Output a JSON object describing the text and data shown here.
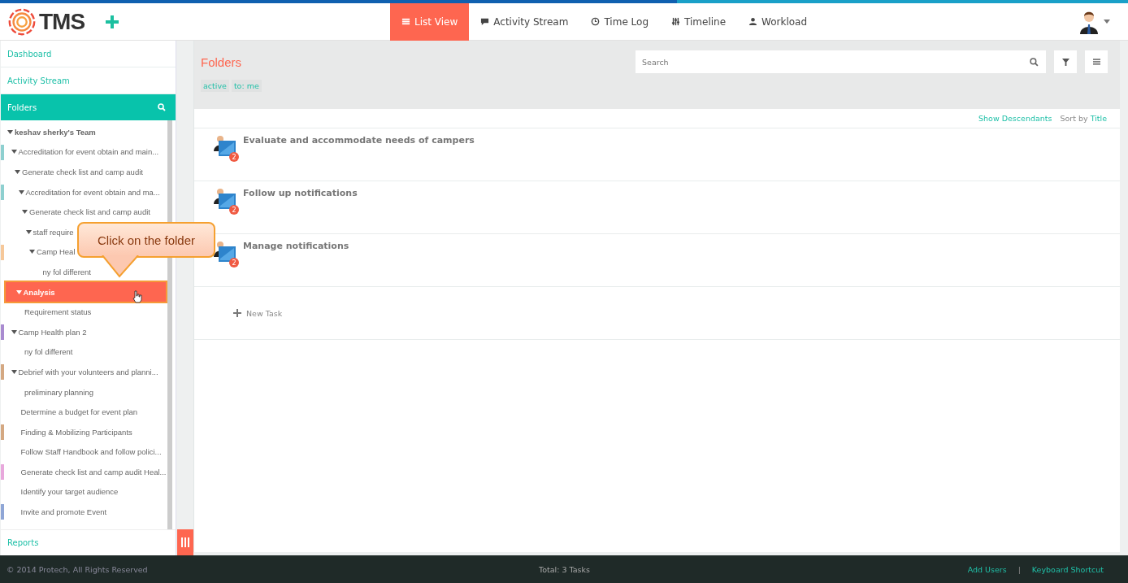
{
  "header": {
    "logo": "TMS",
    "views": [
      {
        "label": "List View",
        "selected": true
      },
      {
        "label": "Activity Stream",
        "selected": false
      },
      {
        "label": "Time Log",
        "selected": false
      },
      {
        "label": "Timeline",
        "selected": false
      },
      {
        "label": "Workload",
        "selected": false
      }
    ]
  },
  "sidebar": {
    "links": [
      "Dashboard",
      "Activity Stream"
    ],
    "folders_title": "Folders",
    "tree": [
      {
        "label": "keshav sherky's Team",
        "selected": false,
        "children": [
          {
            "label": "Accreditation for event obtain and main...",
            "color": "#8ed0d0",
            "selected": false,
            "children": [
              {
                "label": "Generate check list and camp audit",
                "selected": false,
                "children": [
                  {
                    "label": "Accreditation for event obtain and ma...",
                    "color": "#8ed0d0",
                    "selected": false,
                    "children": [
                      {
                        "label": "Generate check list and camp audit",
                        "selected": false,
                        "children": [
                          {
                            "label": "staff require",
                            "selected": false,
                            "children": [
                              {
                                "label": "Camp Heal",
                                "color": "#f6c89a",
                                "selected": false,
                                "children": [
                                  {
                                    "label": "ny fol different",
                                    "selected": false
                                  }
                                ]
                              }
                            ]
                          }
                        ]
                      }
                    ]
                  }
                ]
              }
            ]
          },
          {
            "label": "Analysis",
            "selected": true,
            "children": [
              {
                "label": "Requirement status",
                "selected": false
              }
            ]
          },
          {
            "label": "Camp Health plan 2",
            "color": "#a98bd0",
            "selected": false,
            "children": [
              {
                "label": "ny fol different",
                "selected": false
              }
            ]
          },
          {
            "label": "Debrief with your volunteers and planni...",
            "color": "#d4a882",
            "selected": false,
            "children": [
              {
                "label": "preliminary planning",
                "selected": false
              }
            ]
          },
          {
            "label": "Determine a budget for event plan",
            "selected": false
          },
          {
            "label": "Finding & Mobilizing Participants",
            "color": "#d4a882",
            "selected": false
          },
          {
            "label": "Follow Staff Handbook and follow polici...",
            "selected": false
          },
          {
            "label": "Generate check list and camp audit Heal...",
            "color": "#e8a8dc",
            "selected": false
          },
          {
            "label": "Identify your target audience",
            "selected": false
          },
          {
            "label": "Invite and promote Event",
            "color": "#8fa6d6",
            "selected": false
          }
        ]
      }
    ],
    "reports": "Reports"
  },
  "callout": "Click on the folder",
  "main": {
    "title": "Folders",
    "filters": [
      "active",
      "to: me"
    ],
    "search": {
      "placeholder": "Search"
    },
    "show_descendants": "Show Descendants",
    "sort_label": "Sort by",
    "sort_value": "Title",
    "tasks": [
      {
        "title": "Evaluate and accommodate needs of campers",
        "count": "2"
      },
      {
        "title": "Follow up notifications",
        "count": "2"
      },
      {
        "title": "Manage notifications",
        "count": "2"
      }
    ],
    "new_task": "New Task"
  },
  "footer": {
    "copyright": "© 2014 Protech, All Rights Reserved",
    "total": "Total: 3 Tasks",
    "links": [
      "Add Users",
      "Keyboard Shortcut"
    ],
    "separator": "|"
  }
}
